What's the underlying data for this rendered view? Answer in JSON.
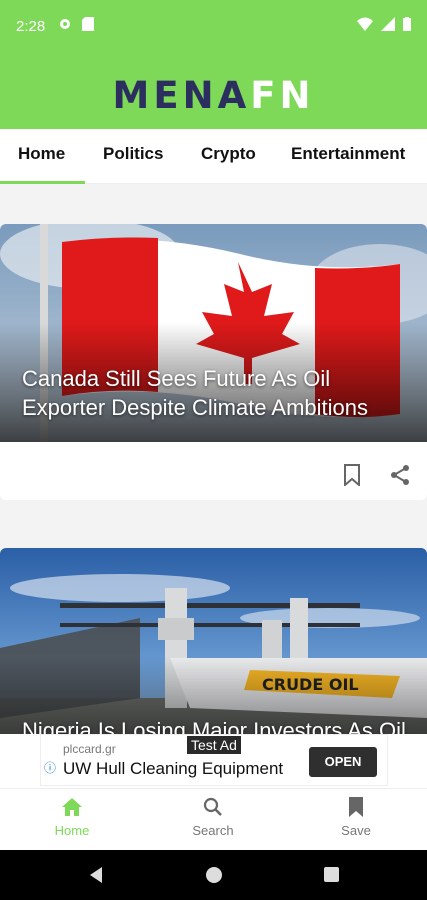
{
  "status_bar": {
    "time": "2:28"
  },
  "header": {
    "logo_part1": "MENA",
    "logo_part2": "FN"
  },
  "tabs": [
    {
      "label": "Home",
      "active": true
    },
    {
      "label": "Politics",
      "active": false
    },
    {
      "label": "Crypto",
      "active": false
    },
    {
      "label": "Entertainment",
      "active": false
    }
  ],
  "articles": [
    {
      "title": "Canada Still Sees Future As Oil Exporter Despite Climate Ambitions"
    },
    {
      "title": "Nigeria Is Losing Major Investors As Oil Theft Runs Rampant"
    }
  ],
  "ad": {
    "label": "Test Ad",
    "domain": "plccard.gr",
    "title": "UW Hull Cleaning Equipment",
    "cta": "OPEN"
  },
  "bottom_nav": [
    {
      "label": "Home",
      "icon": "home-icon",
      "active": true
    },
    {
      "label": "Search",
      "icon": "search-icon",
      "active": false
    },
    {
      "label": "Save",
      "icon": "bookmark-icon",
      "active": false
    }
  ],
  "colors": {
    "brand_green": "#7dd957",
    "logo_navy": "#2b2e5e"
  }
}
